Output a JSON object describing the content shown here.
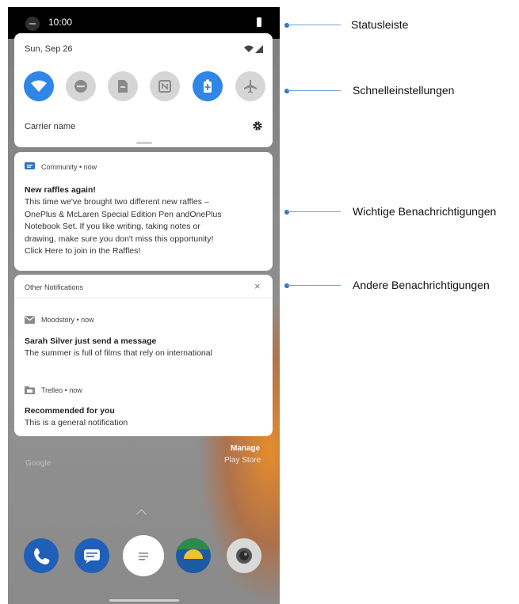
{
  "status_bar": {
    "time": "10:00"
  },
  "quick_settings": {
    "date": "Sun, Sep 26",
    "carrier": "Carrier name",
    "tiles": [
      {
        "icon": "wifi-icon",
        "active": true
      },
      {
        "icon": "do-not-disturb-icon",
        "active": false
      },
      {
        "icon": "screenshot-icon",
        "active": false
      },
      {
        "icon": "nfc-icon",
        "active": false
      },
      {
        "icon": "battery-saver-icon",
        "active": true
      },
      {
        "icon": "airplane-mode-icon",
        "active": false
      }
    ]
  },
  "important_notification": {
    "app": "Community • now",
    "title": "New raffles again!",
    "body": [
      "This time we've brought two different new raffles –",
      "OnePlus & McLaren Special Edition Pen andOnePlus",
      "Notebook Set. If you like writing, taking notes or",
      "drawing, make sure you don't miss this opportunity!",
      "Click Here to join in the Raffles!"
    ]
  },
  "other_notifications": {
    "header": "Other Notifications",
    "close_icon": "×",
    "items": [
      {
        "app": "Moodstory • now",
        "title": "Sarah Silver just send a message",
        "body": "The summer is full of films that rely on international"
      },
      {
        "app": "Trelleo • now",
        "title": "Recommended for you",
        "body": "This is a general notification"
      }
    ]
  },
  "home": {
    "google_label": "Google",
    "manage_label": "Manage",
    "playstore_label": "Play Store"
  },
  "callouts": {
    "statusbar": "Statusleiste",
    "quick_settings": "Schnelleinstellungen",
    "important": "Wichtige Benachrichtigungen",
    "other": "Andere Benachrichtigungen"
  },
  "colors": {
    "accent": "#2f86e6",
    "tile_inactive": "#d6d6d6",
    "callout": "#2f73c4"
  }
}
